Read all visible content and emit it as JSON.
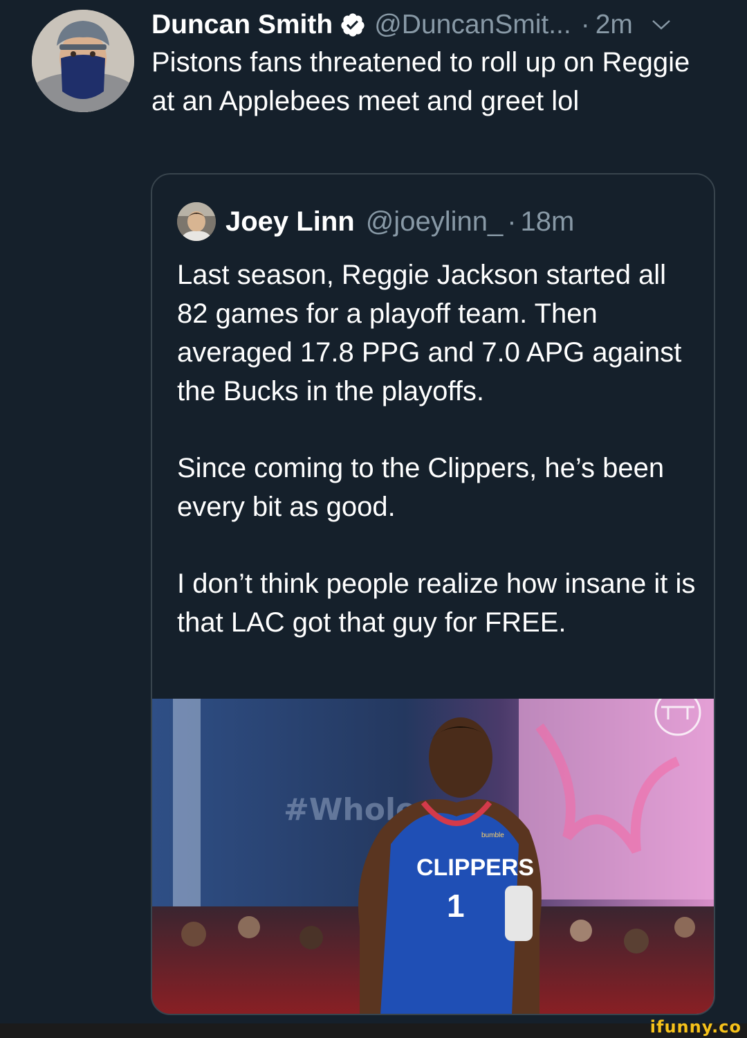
{
  "tweet": {
    "display_name": "Duncan Smith",
    "handle": "@DuncanSmit...",
    "separator": "·",
    "time": "2m",
    "text": "Pistons fans threatened to roll up on Reggie at an Applebees meet and greet lol",
    "avatar_icon": "profile-photo",
    "verified_icon": "verified-badge-icon",
    "menu_icon": "chevron-down-icon"
  },
  "quoted_tweet": {
    "display_name": "Joey Linn",
    "handle": "@joeylinn_",
    "separator": "·",
    "time": "18m",
    "paragraphs": [
      "Last season, Reggie Jackson started all 82 games for a playoff team. Then averaged 17.8 PPG and 7.0 APG against the Bucks in the playoffs.",
      "Since coming to the Clippers, he’s been every bit as good.",
      "I don’t think people realize how insane it is that LAC got that guy for FREE."
    ],
    "media": {
      "jersey_text": "CLIPPERS",
      "jersey_number": "1",
      "sponsor_text": "bumble"
    }
  },
  "watermark": "ifunny.co",
  "colors": {
    "background": "#15202b",
    "text": "#ffffff",
    "secondary_text": "#8899a6",
    "border": "#38444d",
    "verified": "#ffffff",
    "watermark": "#f6c21a"
  }
}
